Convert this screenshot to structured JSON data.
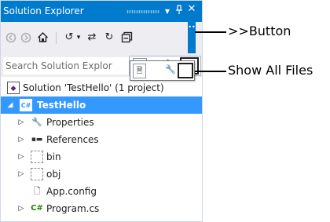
{
  "panel": {
    "title": "Solution Explorer",
    "title_buttons": {
      "dropdown": "▼",
      "pin": "ᵖ",
      "close": "✕"
    },
    "toolbar": {
      "back": "◯",
      "forward": "◯",
      "home": "⌂",
      "history": "↺",
      "history_drop": "▾",
      "sync": "⇄",
      "refresh": "↻",
      "collapse": "⧉",
      "overflow": "▪▪"
    },
    "search": {
      "placeholder": "Search Solution Explor"
    },
    "tree": [
      {
        "label": "Solution 'TestHello' (1 project)",
        "icon": "solution-icon",
        "arrow": ""
      },
      {
        "label": "TestHello",
        "icon": "csharp-project-icon",
        "arrow": "◢",
        "selected": true
      },
      {
        "label": "Properties",
        "icon": "wrench-icon",
        "arrow": "▷"
      },
      {
        "label": "References",
        "icon": "references-icon",
        "arrow": "▷"
      },
      {
        "label": "bin",
        "icon": "folder-icon",
        "arrow": "▷"
      },
      {
        "label": "obj",
        "icon": "folder-icon",
        "arrow": "▷"
      },
      {
        "label": "App.config",
        "icon": "config-icon",
        "arrow": ""
      },
      {
        "label": "Program.cs",
        "icon": "csharp-file-icon",
        "arrow": "▷"
      }
    ]
  },
  "callouts": {
    "button_label": ">>Button",
    "show_all_label": "Show All Files"
  },
  "colors": {
    "accent": "#007acc",
    "selection": "#3399ff",
    "toolbar_bg": "#eeeef2"
  }
}
